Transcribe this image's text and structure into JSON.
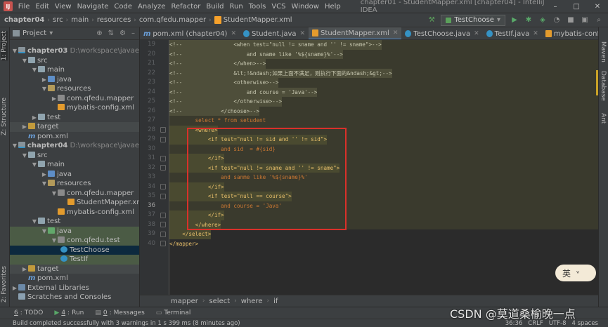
{
  "menubar": {
    "logo": "IJ",
    "items": [
      "File",
      "Edit",
      "View",
      "Navigate",
      "Code",
      "Analyze",
      "Refactor",
      "Build",
      "Run",
      "Tools",
      "VCS",
      "Window",
      "Help"
    ],
    "window_title": "chapter01 - StudentMapper.xml [chapter04] - IntelliJ IDEA",
    "controls": [
      "–",
      "□",
      "✕"
    ]
  },
  "navbar": {
    "breadcrumbs": [
      "chapter04",
      "src",
      "main",
      "resources",
      "com.qfedu.mapper",
      "StudentMapper.xml"
    ],
    "run_config": "TestChoose"
  },
  "left_tabs": [
    "1: Project",
    "Z: Structure",
    "2: Favorites"
  ],
  "right_tabs": [
    "Maven",
    "Database",
    "Ant"
  ],
  "project": {
    "title": "Project",
    "rows": [
      {
        "label": "chapter03",
        "path": "D:\\workspace\\javaee\\chapter03"
      },
      {
        "label": "src"
      },
      {
        "label": "main"
      },
      {
        "label": "java"
      },
      {
        "label": "resources"
      },
      {
        "label": "com.qfedu.mapper"
      },
      {
        "label": "mybatis-config.xml"
      },
      {
        "label": "test"
      },
      {
        "label": "target"
      },
      {
        "label": "pom.xml"
      },
      {
        "label": "chapter04",
        "path": "D:\\workspace\\javaee\\chapter04"
      },
      {
        "label": "src"
      },
      {
        "label": "main"
      },
      {
        "label": "java"
      },
      {
        "label": "resources"
      },
      {
        "label": "com.qfedu.mapper"
      },
      {
        "label": "StudentMapper.xml"
      },
      {
        "label": "mybatis-config.xml"
      },
      {
        "label": "test"
      },
      {
        "label": "java"
      },
      {
        "label": "com.qfedu.test"
      },
      {
        "label": "TestChoose"
      },
      {
        "label": "TestIf"
      },
      {
        "label": "target"
      },
      {
        "label": "pom.xml"
      },
      {
        "label": "External Libraries"
      },
      {
        "label": "Scratches and Consoles"
      }
    ]
  },
  "tabs": [
    "pom.xml (chapter04)",
    "Student.java",
    "StudentMapper.xml",
    "TestChoose.java",
    "TestIf.java",
    "mybatis-config.xml"
  ],
  "editor": {
    "line_numbers": [
      "19",
      "20",
      "21",
      "22",
      "23",
      "24",
      "25",
      "26",
      "27",
      "28",
      "29",
      "30",
      "31",
      "32",
      "33",
      "34",
      "35",
      "36",
      "37",
      "38",
      "39",
      "40"
    ],
    "lines": [
      "<!--                <when test=\"null != sname and '' != sname\">-->",
      "<!--                    and sname like '%${sname}%'-->",
      "<!--                </when>-->",
      "<!--                &lt;!&ndash;如果上面不满足，则执行下面的&ndash;&gt;-->",
      "<!--                <otherwise>-->",
      "<!--                    and course = 'Java'-->",
      "<!--                </otherwise>-->",
      "<!--            </choose>-->",
      "        select * from setudent",
      "        <where>",
      "            <if test=\"null != sid and '' != sid\">",
      "                and sid  = #{sid}",
      "            </if>",
      "            <if test=\"null != sname and '' != sname\">",
      "                and sanme like '%${sname}%'",
      "            </if>",
      "            <if test=\"null == course\">",
      "                and course = 'Java'",
      "            </if>",
      "        </where>",
      "    </select>",
      "</mapper>"
    ]
  },
  "breadcrumb_bottom": [
    "mapper",
    "select",
    "where",
    "if"
  ],
  "toolwindows": [
    {
      "num": "6",
      "label": "TODO"
    },
    {
      "num": "4",
      "label": "Run"
    },
    {
      "num": "0",
      "label": "Messages"
    },
    {
      "num": "",
      "label": "Terminal"
    }
  ],
  "status": {
    "message": "Build completed successfully with 3 warnings in 1 s 399 ms (8 minutes ago)",
    "position": "36:36",
    "line_sep": "CRLF",
    "encoding": "UTF-8",
    "indent": "4 spaces"
  },
  "watermark": "CSDN @莫道桑榆晚一点",
  "ime": {
    "label": "英",
    "extra": "ᵛ"
  },
  "colors": {
    "highlight_box": "#d9302a",
    "accent": "#4a88c7"
  }
}
